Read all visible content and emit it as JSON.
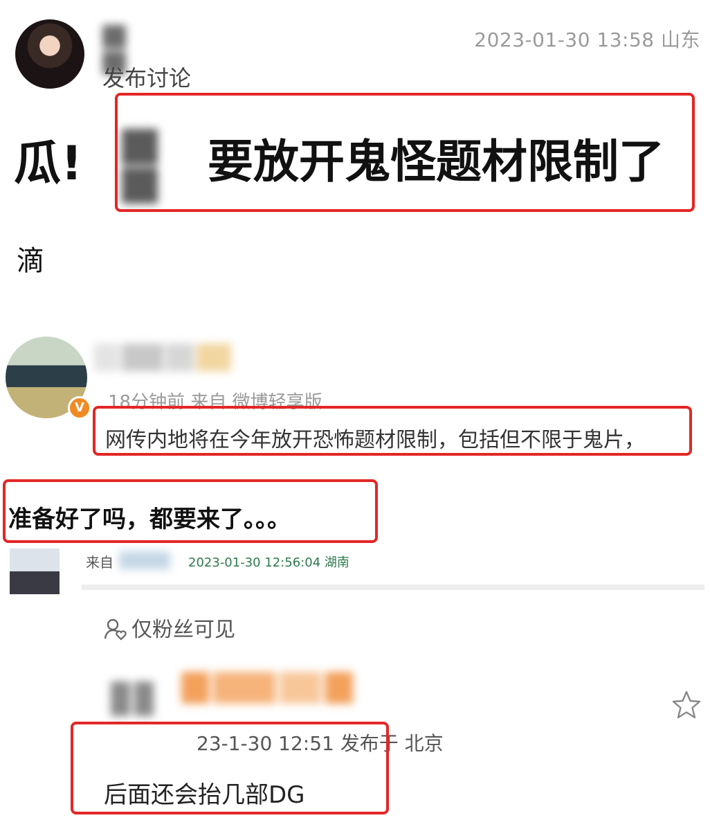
{
  "post": {
    "meta": "2023-01-30 13:58 山东",
    "subtitle": "发布讨论",
    "headline_prefix": "瓜!",
    "headline_main": "要放开鬼怪题材限制了",
    "body": "滴"
  },
  "comment1": {
    "meta": "18分钟前  来自 微博轻享版",
    "text": "网传内地将在今年放开恐怖题材限制，包括但不限于鬼片，",
    "continuation": "准备好了吗，都要来了。。。",
    "verified_badge": "V"
  },
  "comment2": {
    "source_label": "来自",
    "time": "2023-01-30 12:56:04 湖南"
  },
  "visibility": {
    "label": "仅粉丝可见",
    "icon": "fans-icon"
  },
  "comment3": {
    "meta": "23-1-30 12:51   发布于 北京",
    "text": "后面还会抬几部DG",
    "icon": "star-icon"
  },
  "colors": {
    "highlight_box": "#e32626",
    "meta_gray": "#9a9a9a",
    "verified_orange": "#f08a24"
  }
}
